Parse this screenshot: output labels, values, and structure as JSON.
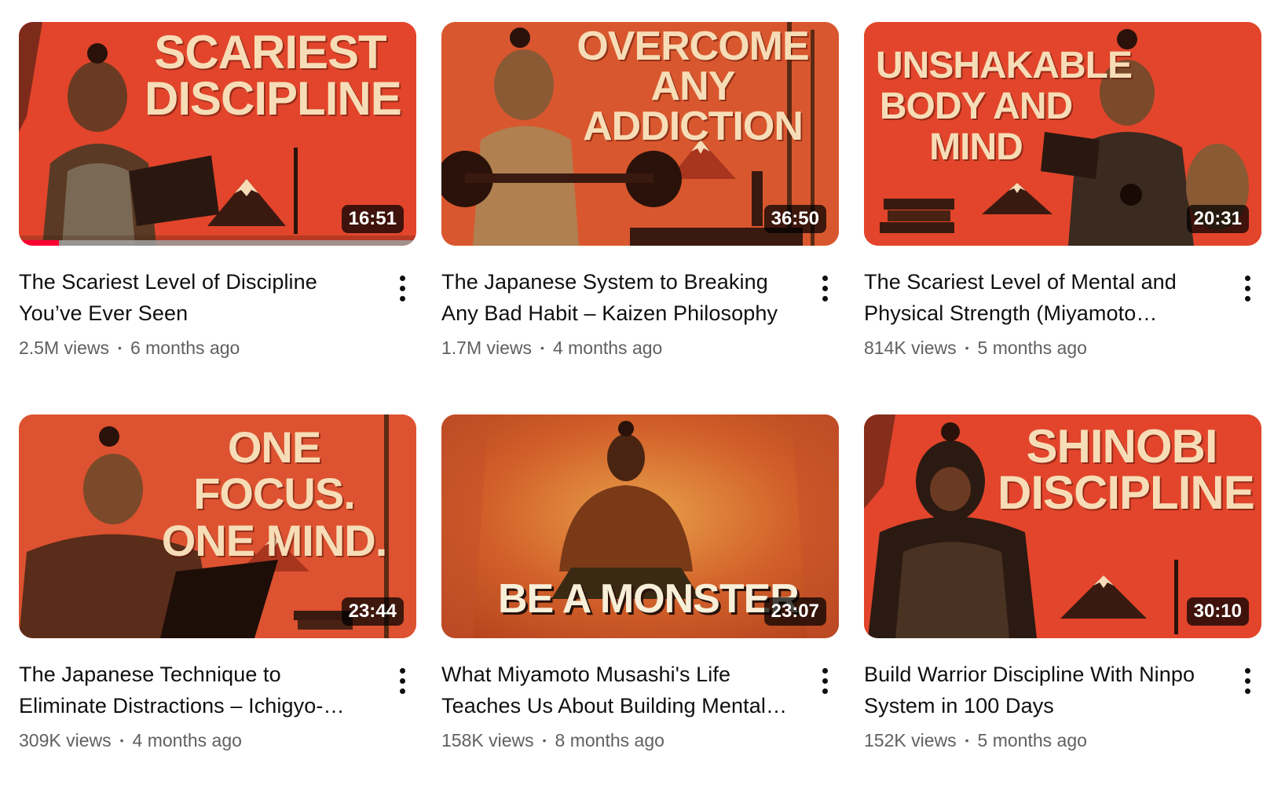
{
  "colors": {
    "thumb_red": "#e2452b",
    "thumb_text": "#f6ddb7",
    "progress_red": "#ff0033",
    "secondary_text": "#606060"
  },
  "videos": [
    {
      "thumb_text": "SCARIEST DISCIPLINE",
      "duration": "16:51",
      "watch_progress": 0.1,
      "title": "The Scariest Level of Discipline You’ve Ever Seen",
      "views": "2.5M views",
      "age": "6 months ago"
    },
    {
      "thumb_text": "OVERCOME ANY ADDICTION",
      "duration": "36:50",
      "title": "The Japanese System to Breaking Any Bad Habit – Kaizen Philosophy",
      "views": "1.7M views",
      "age": "4 months ago"
    },
    {
      "thumb_text": "UNSHAKABLE BODY AND MIND",
      "duration": "20:31",
      "title": "The Scariest Level of Mental and Physical Strength (Miyamoto…",
      "views": "814K views",
      "age": "5 months ago"
    },
    {
      "thumb_text": "ONE FOCUS. ONE MIND.",
      "duration": "23:44",
      "title": "The Japanese Technique to Eliminate Distractions – Ichigyo-…",
      "views": "309K views",
      "age": "4 months ago"
    },
    {
      "thumb_text": "BE A MONSTER",
      "duration": "23:07",
      "title": "What Miyamoto Musashi's Life Teaches Us About Building Mental…",
      "views": "158K views",
      "age": "8 months ago"
    },
    {
      "thumb_text": "SHINOBI DISCIPLINE",
      "duration": "30:10",
      "title": "Build Warrior Discipline With Ninpo System in 100 Days",
      "views": "152K views",
      "age": "5 months ago"
    }
  ]
}
